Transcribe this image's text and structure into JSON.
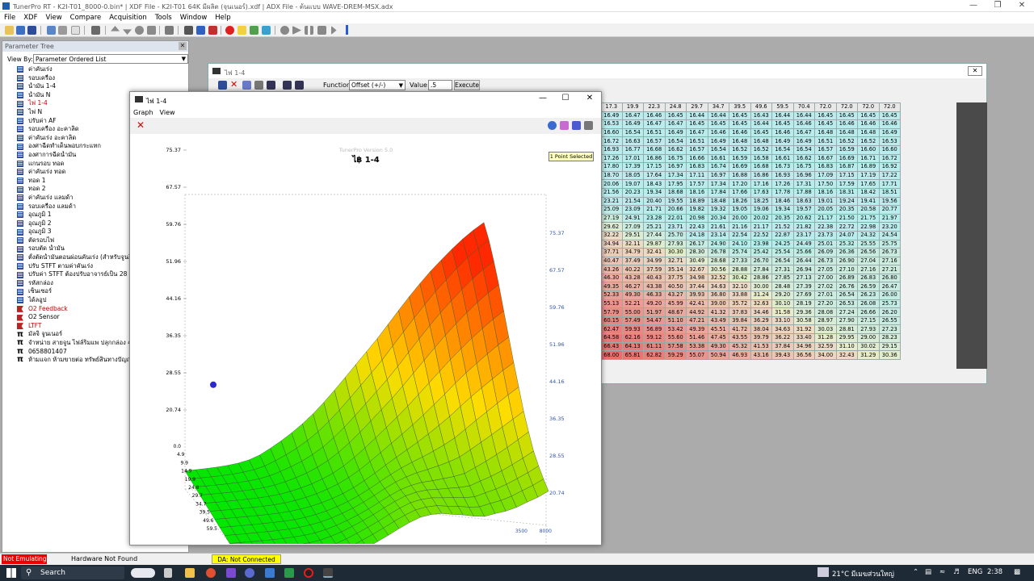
{
  "app": {
    "title": "TunerPro RT - K2I-T01_8000-0.bin* | XDF File - K2I-T01 64K มีผลิต (จุนเนอร์).xdf | ADX File - ต้นแบบ WAVE-DREM-MSX.adx",
    "menu": [
      "File",
      "XDF",
      "View",
      "Compare",
      "Acquisition",
      "Tools",
      "Window",
      "Help"
    ]
  },
  "param_tree": {
    "header": "Parameter Tree",
    "view_by_label": "View By:",
    "view_by_value": "Parameter Ordered List",
    "items": [
      {
        "label": "ค่าคันเร่ง",
        "icon": "table",
        "red": false
      },
      {
        "label": "รอบเครื่อง",
        "icon": "table",
        "red": false
      },
      {
        "label": "น้ำมัน 1-4",
        "icon": "table",
        "red": false
      },
      {
        "label": "น้ำมัน N",
        "icon": "table",
        "red": false
      },
      {
        "label": "ไฟ 1-4",
        "icon": "table",
        "red": true
      },
      {
        "label": "ไฟ N",
        "icon": "table",
        "red": false
      },
      {
        "label": "ปรับค่า AF",
        "icon": "table",
        "red": false
      },
      {
        "label": "รอบเครื่อง อะคาลิด",
        "icon": "table",
        "red": false
      },
      {
        "label": "ค่าคันเร่ง อะคาลิด",
        "icon": "table",
        "red": false
      },
      {
        "label": "องศาฉีดทำเด็นพอบกระแทก",
        "icon": "table",
        "red": false
      },
      {
        "label": "องศาการฉีดน้ำมัน",
        "icon": "table",
        "red": false
      },
      {
        "label": "แกนรอบ ทอด",
        "icon": "table",
        "red": false
      },
      {
        "label": "ค่าคันเร่ง ทอด",
        "icon": "table",
        "red": false
      },
      {
        "label": "ทอด 1",
        "icon": "table",
        "red": false
      },
      {
        "label": "ทอด 2",
        "icon": "table",
        "red": false
      },
      {
        "label": "ค่าคันเร่ง แลมด้า",
        "icon": "table",
        "red": false
      },
      {
        "label": "รอบเครื่อง แลมด้า",
        "icon": "table",
        "red": false
      },
      {
        "label": "อุณภูมิ 1",
        "icon": "table",
        "red": false
      },
      {
        "label": "อุณภูมิ 2",
        "icon": "table",
        "red": false
      },
      {
        "label": "อุณภูมิ 3",
        "icon": "table",
        "red": false
      },
      {
        "label": "ตัดรอบไฟ",
        "icon": "table",
        "red": false
      },
      {
        "label": "รอบตัด น้ำมัน",
        "icon": "table",
        "red": false
      },
      {
        "label": "ตั้งตัดน้ำมันตอนผ่อนคันเร่ง (สำหรับจูนยิง)",
        "icon": "table",
        "red": false
      },
      {
        "label": "ปรับ STFT ตามค่าคันเร่ง",
        "icon": "table",
        "red": false
      },
      {
        "label": "ปรับค่า STFT ต้องปรับอาจารย์เป็น 28",
        "icon": "table",
        "red": false
      },
      {
        "label": "รหัสกล่อง",
        "icon": "table",
        "red": false
      },
      {
        "label": "เซ็นเซอร์",
        "icon": "table",
        "red": false
      },
      {
        "label": "ได้ลอูป",
        "icon": "table",
        "red": false
      },
      {
        "label": "O2 Feedback",
        "icon": "flag",
        "red": true
      },
      {
        "label": "O2 Sensor",
        "icon": "flag",
        "red": false
      },
      {
        "label": "LTFT",
        "icon": "flag",
        "red": true
      },
      {
        "label": "มัลจิ จูนเนอร์",
        "icon": "pi",
        "red": false
      },
      {
        "label": "จำหน่าย สายจูน ไฟล์ริมแพ ปลุกกล่อง 48K",
        "icon": "pi",
        "red": false
      },
      {
        "label": "0658801407",
        "icon": "pi",
        "red": false
      },
      {
        "label": "ห้ามแจก ห้ามขายต่อ ทรัพย์สินทางปัญญา",
        "icon": "pi",
        "red": false
      }
    ]
  },
  "table_window": {
    "title": "ไฟ 1-4",
    "function_label": "Function:",
    "function_value": "Offset (+/-)",
    "value_label": "Value:",
    "value": ".5",
    "execute_label": "Execute",
    "col_headers": [
      "17.3",
      "19.9",
      "22.3",
      "24.8",
      "29.7",
      "34.7",
      "39.5",
      "49.6",
      "59.5",
      "70.4",
      "72.0",
      "72.0",
      "72.0",
      "72.0"
    ],
    "rows": [
      [
        "16.49",
        "16.47",
        "16.46",
        "16.45",
        "16.44",
        "16.44",
        "16.45",
        "16.43",
        "16.44",
        "16.44",
        "16.45",
        "16.45",
        "16.45",
        "16.45"
      ],
      [
        "16.53",
        "16.49",
        "16.47",
        "16.47",
        "16.45",
        "16.45",
        "16.45",
        "16.44",
        "16.45",
        "16.46",
        "16.45",
        "16.46",
        "16.46",
        "16.46"
      ],
      [
        "16.60",
        "16.54",
        "16.51",
        "16.49",
        "16.47",
        "16.46",
        "16.46",
        "16.45",
        "16.46",
        "16.47",
        "16.48",
        "16.48",
        "16.48",
        "16.49"
      ],
      [
        "16.72",
        "16.63",
        "16.57",
        "16.54",
        "16.51",
        "16.49",
        "16.48",
        "16.48",
        "16.49",
        "16.49",
        "16.51",
        "16.52",
        "16.52",
        "16.53"
      ],
      [
        "16.93",
        "16.77",
        "16.68",
        "16.62",
        "16.57",
        "16.54",
        "16.52",
        "16.52",
        "16.54",
        "16.54",
        "16.57",
        "16.59",
        "16.60",
        "16.60"
      ],
      [
        "17.26",
        "17.01",
        "16.86",
        "16.75",
        "16.66",
        "16.61",
        "16.59",
        "16.58",
        "16.61",
        "16.62",
        "16.67",
        "16.69",
        "16.71",
        "16.72"
      ],
      [
        "17.80",
        "17.39",
        "17.15",
        "16.97",
        "16.83",
        "16.74",
        "16.69",
        "16.68",
        "16.73",
        "16.75",
        "16.83",
        "16.87",
        "16.89",
        "16.92"
      ],
      [
        "18.70",
        "18.05",
        "17.64",
        "17.34",
        "17.11",
        "16.97",
        "16.88",
        "16.86",
        "16.93",
        "16.96",
        "17.09",
        "17.15",
        "17.19",
        "17.22"
      ],
      [
        "20.06",
        "19.07",
        "18.43",
        "17.95",
        "17.57",
        "17.34",
        "17.20",
        "17.16",
        "17.26",
        "17.31",
        "17.50",
        "17.59",
        "17.65",
        "17.71"
      ],
      [
        "21.56",
        "20.23",
        "19.34",
        "18.68",
        "18.16",
        "17.84",
        "17.66",
        "17.63",
        "17.78",
        "17.88",
        "18.16",
        "18.31",
        "18.42",
        "18.51"
      ],
      [
        "23.21",
        "21.54",
        "20.40",
        "19.55",
        "18.89",
        "18.48",
        "18.26",
        "18.25",
        "18.46",
        "18.63",
        "19.01",
        "19.24",
        "19.41",
        "19.56"
      ],
      [
        "25.09",
        "23.09",
        "21.71",
        "20.66",
        "19.82",
        "19.32",
        "19.05",
        "19.06",
        "19.34",
        "19.57",
        "20.05",
        "20.35",
        "20.58",
        "20.77"
      ],
      [
        "27.19",
        "24.91",
        "23.28",
        "22.01",
        "20.98",
        "20.34",
        "20.00",
        "20.02",
        "20.35",
        "20.62",
        "21.17",
        "21.50",
        "21.75",
        "21.97"
      ],
      [
        "29.62",
        "27.09",
        "25.21",
        "23.71",
        "22.43",
        "21.61",
        "21.16",
        "21.17",
        "21.52",
        "21.82",
        "22.38",
        "22.72",
        "22.98",
        "23.20"
      ],
      [
        "32.22",
        "29.51",
        "27.44",
        "25.70",
        "24.18",
        "23.14",
        "22.54",
        "22.52",
        "22.87",
        "23.17",
        "23.73",
        "24.07",
        "24.32",
        "24.54"
      ],
      [
        "34.94",
        "32.11",
        "29.87",
        "27.93",
        "26.17",
        "24.90",
        "24.10",
        "23.98",
        "24.25",
        "24.49",
        "25.01",
        "25.32",
        "25.55",
        "25.75"
      ],
      [
        "37.71",
        "34.79",
        "32.41",
        "30.30",
        "28.30",
        "26.78",
        "25.74",
        "25.42",
        "25.54",
        "25.66",
        "26.09",
        "26.36",
        "26.56",
        "26.73"
      ],
      [
        "40.47",
        "37.49",
        "34.99",
        "32.71",
        "30.49",
        "28.68",
        "27.33",
        "26.70",
        "26.54",
        "26.44",
        "26.73",
        "26.90",
        "27.04",
        "27.16"
      ],
      [
        "43.26",
        "40.22",
        "37.59",
        "35.14",
        "32.67",
        "30.56",
        "28.88",
        "27.84",
        "27.31",
        "26.94",
        "27.05",
        "27.10",
        "27.16",
        "27.21"
      ],
      [
        "46.30",
        "43.28",
        "40.43",
        "37.75",
        "34.98",
        "32.52",
        "30.42",
        "28.86",
        "27.85",
        "27.13",
        "27.00",
        "26.89",
        "26.83",
        "26.80"
      ],
      [
        "49.35",
        "46.27",
        "43.38",
        "40.50",
        "37.44",
        "34.63",
        "32.10",
        "30.00",
        "28.48",
        "27.39",
        "27.02",
        "26.76",
        "26.59",
        "26.47"
      ],
      [
        "52.33",
        "49.30",
        "46.33",
        "43.27",
        "39.93",
        "36.80",
        "33.88",
        "31.24",
        "29.20",
        "27.69",
        "27.01",
        "26.54",
        "26.23",
        "26.00"
      ],
      [
        "55.13",
        "52.21",
        "49.20",
        "45.99",
        "42.41",
        "39.00",
        "35.72",
        "32.63",
        "30.10",
        "28.19",
        "27.20",
        "26.53",
        "26.08",
        "25.73"
      ],
      [
        "57.79",
        "55.00",
        "51.97",
        "48.67",
        "44.92",
        "41.32",
        "37.83",
        "34.46",
        "31.58",
        "29.36",
        "28.08",
        "27.24",
        "26.66",
        "26.20"
      ],
      [
        "60.15",
        "57.49",
        "54.47",
        "51.10",
        "47.21",
        "43.49",
        "39.84",
        "36.29",
        "33.10",
        "30.58",
        "28.97",
        "27.90",
        "27.15",
        "26.55"
      ],
      [
        "62.47",
        "59.93",
        "56.89",
        "53.42",
        "49.39",
        "45.51",
        "41.72",
        "38.04",
        "34.63",
        "31.92",
        "30.03",
        "28.81",
        "27.93",
        "27.23"
      ],
      [
        "64.58",
        "62.16",
        "59.12",
        "55.60",
        "51.46",
        "47.45",
        "43.55",
        "39.79",
        "36.22",
        "33.40",
        "31.28",
        "29.95",
        "29.00",
        "28.23"
      ],
      [
        "66.43",
        "64.13",
        "61.11",
        "57.58",
        "53.38",
        "49.30",
        "45.32",
        "41.53",
        "37.84",
        "34.96",
        "32.59",
        "31.10",
        "30.02",
        "29.15"
      ],
      [
        "68.00",
        "65.81",
        "62.82",
        "59.29",
        "55.07",
        "50.94",
        "46.93",
        "43.16",
        "39.43",
        "36.56",
        "34.00",
        "32.43",
        "31.29",
        "30.36"
      ]
    ]
  },
  "graph_window": {
    "title": "ไฟ 1-4",
    "menu": [
      "Graph",
      "View"
    ],
    "plot_title": "ไ฿ 1-4",
    "watermark": "TunerPro   Version 5.0",
    "point_selected": "1 Point Selected",
    "z_ticks_left": [
      "75.37",
      "67.57",
      "59.76",
      "51.96",
      "44.16",
      "36.35",
      "28.55",
      "20.74"
    ],
    "z_ticks_right": [
      "75.37",
      "67.57",
      "59.76",
      "51.96",
      "44.16",
      "36.35",
      "28.55",
      "20.74"
    ],
    "y_ticks": [
      "0.0",
      "4.9",
      "9.9",
      "14.9",
      "19.9",
      "24.8",
      "29.7",
      "34.7",
      "39.5",
      "49.6",
      "59.5"
    ],
    "x_ticks": [
      "8000",
      "3500"
    ]
  },
  "status": {
    "emulation": "Not Emulating",
    "hardware": "Hardware Not Found",
    "da": "DA: Not Connected"
  },
  "taskbar": {
    "search_placeholder": "Search",
    "weather": "21°C มีเมฆส่วนใหญ่",
    "lang": "ENG",
    "time": "2:38"
  },
  "colors": {
    "table_cool": "#b9ecec",
    "table_hot": "#e88a8a",
    "surface_low": "#00e000",
    "surface_high": "#ff4000",
    "statusbar_red": "#e00000",
    "statusbar_yellow": "#ffff00"
  }
}
